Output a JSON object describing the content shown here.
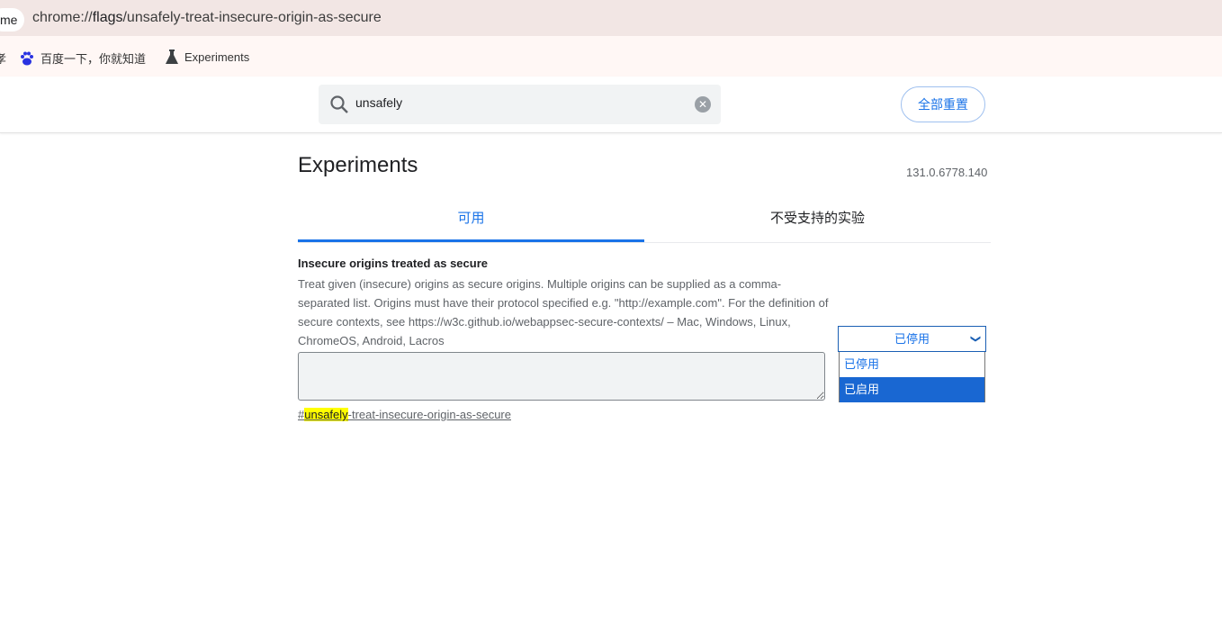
{
  "browser": {
    "tab_fragment": "me",
    "url_prefix": "chrome://",
    "url_host": "flags",
    "url_path": "/unsafely-treat-insecure-origin-as-secure",
    "bookmarks": [
      {
        "label": "百度一下，你就知道",
        "icon": "baidu-icon"
      },
      {
        "label": "Experiments",
        "icon": "flask-icon"
      }
    ],
    "bookmark_fragment": "孝"
  },
  "header": {
    "search_value": "unsafely",
    "reset_label": "全部重置"
  },
  "page": {
    "title": "Experiments",
    "version": "131.0.6778.140",
    "tabs": [
      {
        "label": "可用",
        "active": true
      },
      {
        "label": "不受支持的实验",
        "active": false
      }
    ]
  },
  "experiment": {
    "name": "Insecure origins treated as secure",
    "description": "Treat given (insecure) origins as secure origins. Multiple origins can be supplied as a comma-separated list. Origins must have their protocol specified e.g. \"http://example.com\". For the definition of secure contexts, see https://w3c.github.io/webappsec-secure-contexts/ – Mac, Windows, Linux, ChromeOS, Android, Lacros",
    "textarea_value": "",
    "link_prefix": "#",
    "link_highlight": "unsafely",
    "link_rest": "-treat-insecure-origin-as-secure",
    "select_value": "已停用",
    "options": [
      "已停用",
      "已启用"
    ],
    "highlighted_option": "已启用"
  },
  "colors": {
    "accent": "#1a73e8",
    "highlight": "#ffff00",
    "option_selected": "#1967d2"
  }
}
